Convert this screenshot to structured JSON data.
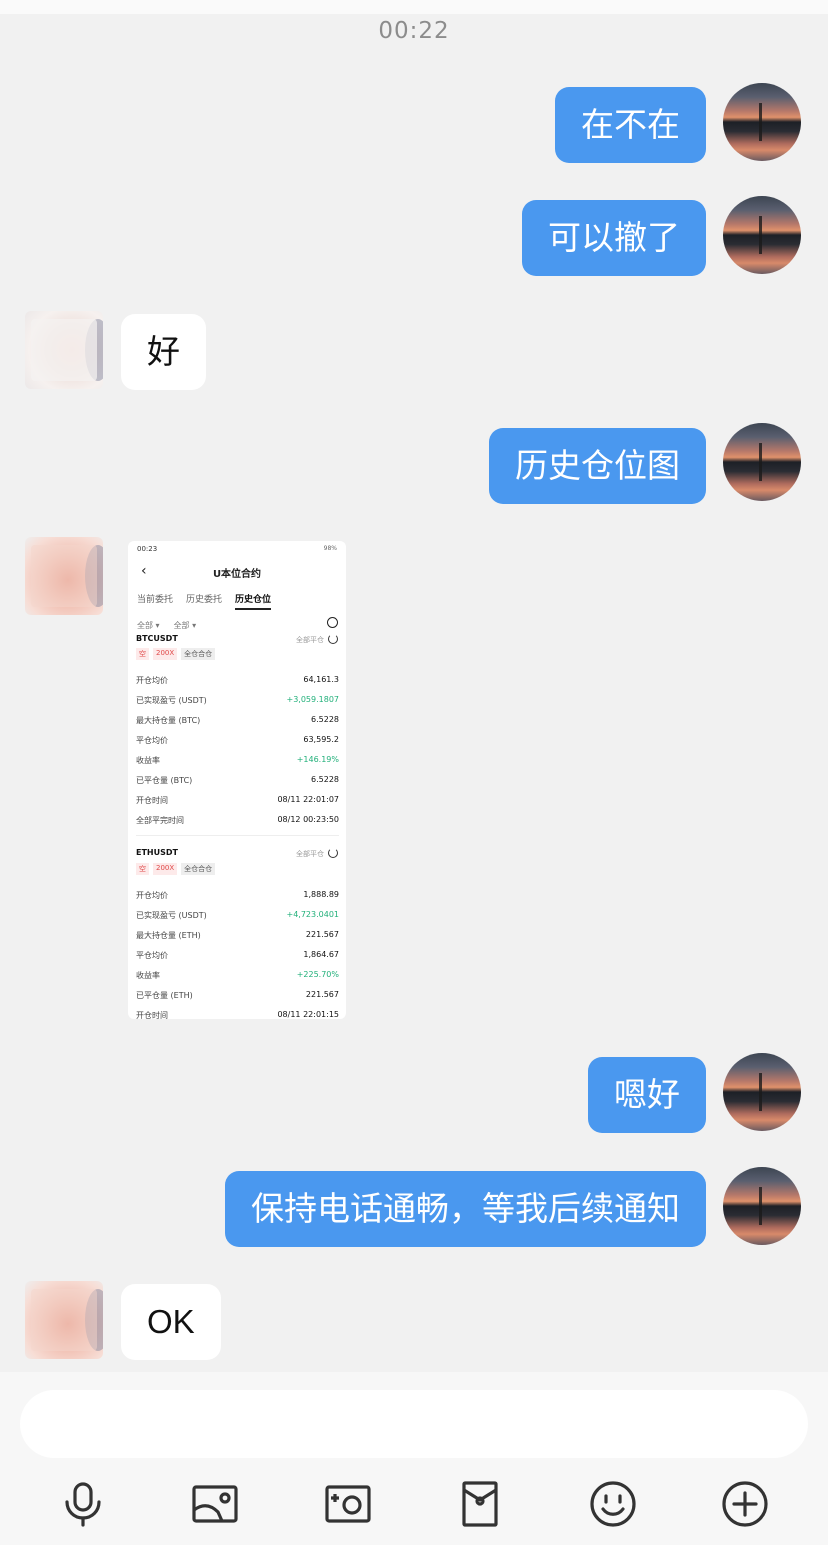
{
  "header": {
    "time": "00:22"
  },
  "messages": [
    {
      "side": "me",
      "text": "在不在"
    },
    {
      "side": "me",
      "text": "可以撤了"
    },
    {
      "side": "other",
      "text": "好"
    },
    {
      "side": "me",
      "text": "历史仓位图"
    },
    {
      "side": "other",
      "type": "image"
    },
    {
      "side": "me",
      "text": "嗯好"
    },
    {
      "side": "me",
      "text": "保持电话通畅，等我后续通知"
    },
    {
      "side": "other",
      "text": "OK"
    }
  ],
  "screenshot": {
    "status_time": "00:23",
    "status_right": "98%",
    "title": "U本位合约",
    "tabs": [
      "当前委托",
      "历史委托",
      "历史仓位"
    ],
    "filters": [
      "全部 ▾",
      "全部 ▾"
    ],
    "positions": [
      {
        "symbol": "BTCUSDT",
        "status": "全部平仓",
        "tags": [
          "空",
          "200X",
          "全仓合仓"
        ],
        "rows": [
          {
            "label": "开仓均价",
            "value": "64,161.3"
          },
          {
            "label": "已实现盈亏 (USDT)",
            "value": "+3,059.1807"
          },
          {
            "label": "最大持仓量 (BTC)",
            "value": "6.5228"
          },
          {
            "label": "平仓均价",
            "value": "63,595.2"
          },
          {
            "label": "收益率",
            "value": "+146.19%"
          },
          {
            "label": "已平仓量 (BTC)",
            "value": "6.5228"
          },
          {
            "label": "开仓时间",
            "value": "08/11 22:01:07"
          },
          {
            "label": "全部平完时间",
            "value": "08/12 00:23:50"
          }
        ]
      },
      {
        "symbol": "ETHUSDT",
        "status": "全部平仓",
        "tags": [
          "空",
          "200X",
          "全仓合仓"
        ],
        "rows": [
          {
            "label": "开仓均价",
            "value": "1,888.89"
          },
          {
            "label": "已实现盈亏 (USDT)",
            "value": "+4,723.0401"
          },
          {
            "label": "最大持仓量 (ETH)",
            "value": "221.567"
          },
          {
            "label": "平仓均价",
            "value": "1,864.67"
          },
          {
            "label": "收益率",
            "value": "+225.70%"
          },
          {
            "label": "已平仓量 (ETH)",
            "value": "221.567"
          },
          {
            "label": "开仓时间",
            "value": "08/11 22:01:15"
          }
        ]
      }
    ]
  },
  "toolbar": [
    "microphone-icon",
    "image-icon",
    "camera-icon",
    "red-packet-icon",
    "emoji-icon",
    "plus-icon"
  ],
  "colors": {
    "sent_bubble": "#4a98ef",
    "received_bubble": "#ffffff",
    "background": "#f1f1f1",
    "profit_green": "#22b07a"
  }
}
